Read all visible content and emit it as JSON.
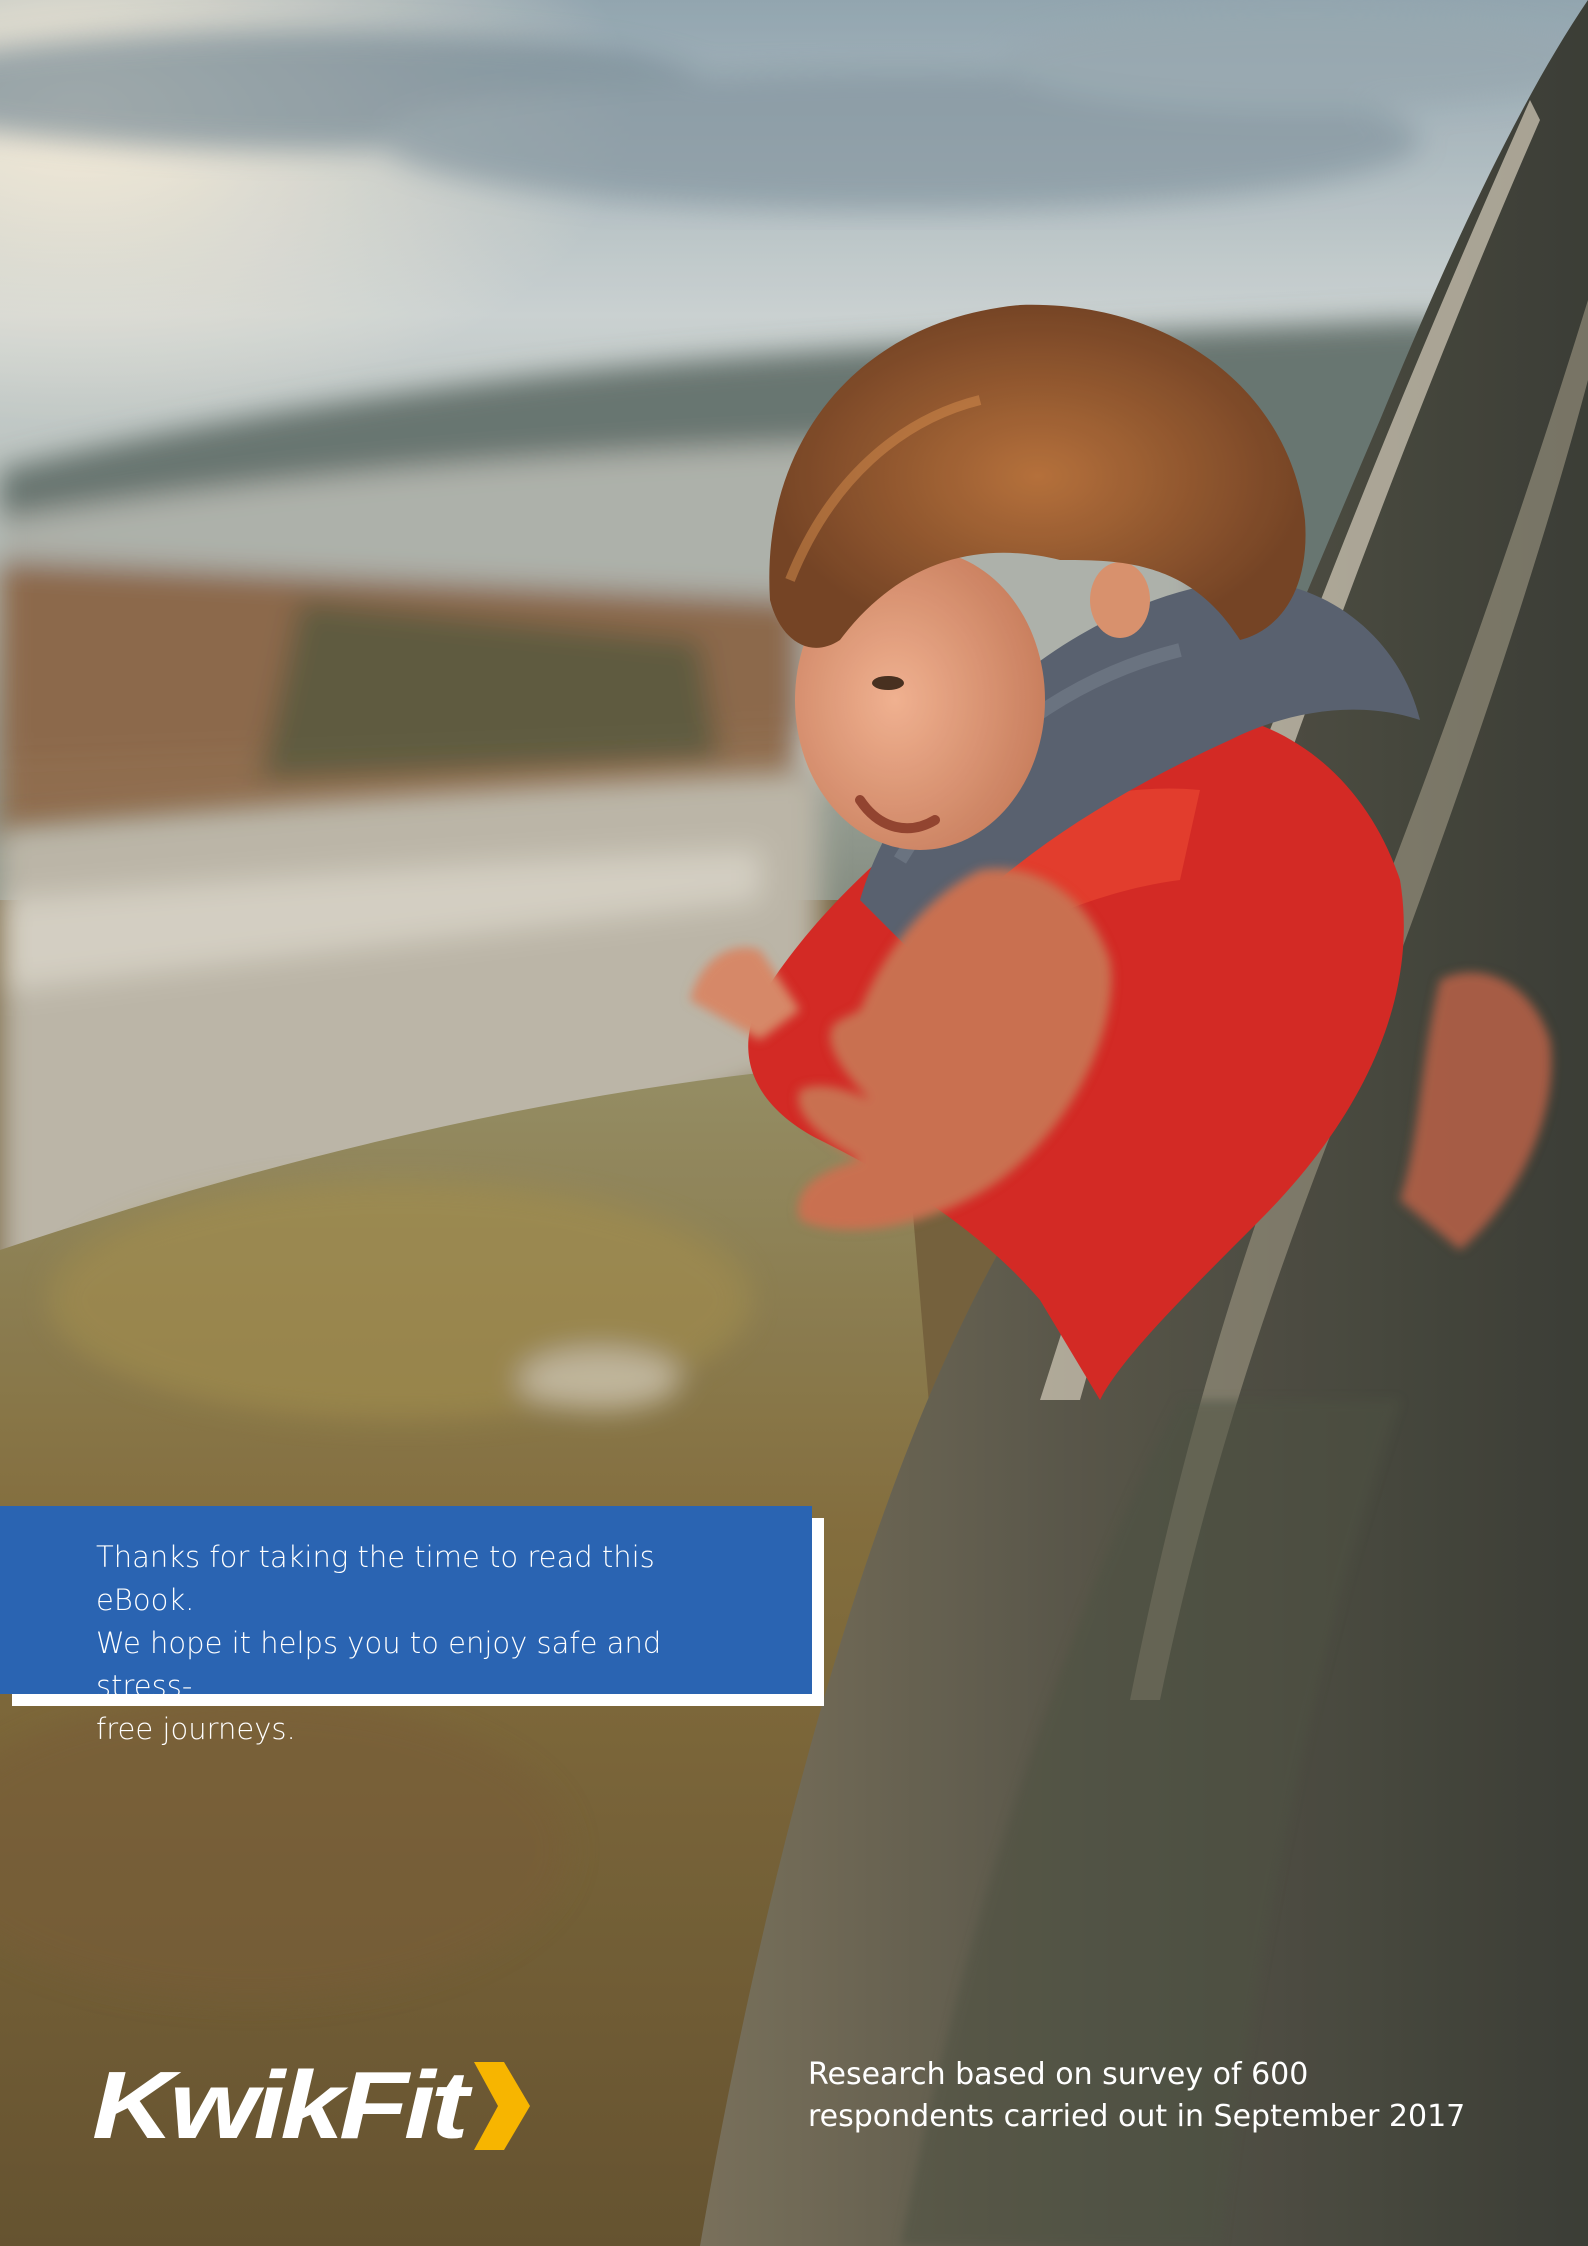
{
  "thanks": {
    "lines": [
      "Thanks for taking the time to read this eBook.",
      "We hope it helps you to enjoy safe and stress-",
      "free journeys."
    ]
  },
  "logo": {
    "text": "KwikFit",
    "icon": "chevron-right-icon",
    "colors": {
      "text": "#ffffff",
      "chevron": "#f7b500"
    }
  },
  "footnote": {
    "lines": [
      "Research based on survey of 600",
      "respondents carried out in September 2017"
    ]
  },
  "colors": {
    "box": "#2a64b2",
    "box_shadow": "#ffffff",
    "text": "#ffffff"
  }
}
